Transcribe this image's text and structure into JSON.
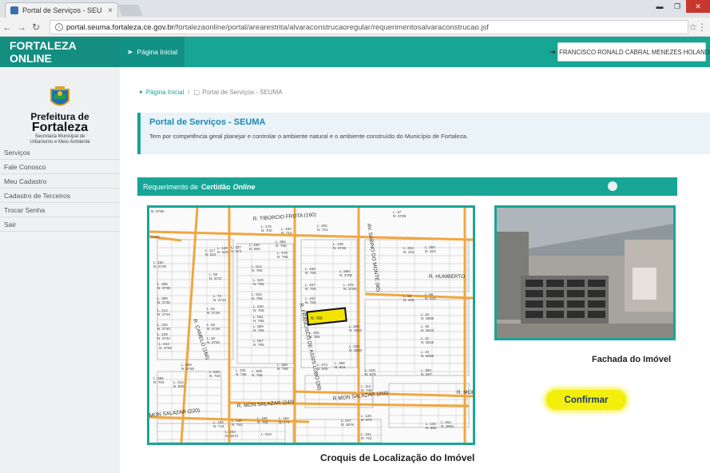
{
  "browser": {
    "tab_title": "Portal de Serviços - SEU",
    "tab_close": "×",
    "url_domain": "portal.seuma.fortaleza.ce.gov.br",
    "url_path": "/fortalezaonline/portal/arearestrita/alvaraconstrucaoregular/requerimentosalvaraconstrucao.jsf",
    "icons": [
      "back-icon",
      "forward-icon",
      "reload-icon",
      "info-icon",
      "star-icon",
      "menu-icon"
    ]
  },
  "header": {
    "brand": "FORTALEZA ONLINE",
    "nav_home": "Página Inicial",
    "user_button": "FRANCISCO RONALD CABRAL MENEZES HOLANDA"
  },
  "sidebar": {
    "logo_line1": "Prefeitura de",
    "logo_line2": "Fortaleza",
    "logo_line3": "Secretaria Municipal de",
    "logo_line4": "Urbanismo e Meio Ambiente",
    "items": [
      {
        "label": "Serviços"
      },
      {
        "label": "Fale Conosco"
      },
      {
        "label": "Meu Cadastro"
      },
      {
        "label": "Cadastro de Terceiros"
      },
      {
        "label": "Trocar Senha"
      },
      {
        "label": "Sair"
      }
    ]
  },
  "breadcrumb": {
    "home": "Página Inicial",
    "separator": "/",
    "current": "Portal de Serviços - SEUMA"
  },
  "portal": {
    "title": "Portal de Serviços - SEUMA",
    "description": "Tem por competência geral planejar e controlar o ambiente natural e o ambiente construído do Município de Fortaleza."
  },
  "request": {
    "prefix": "Requerimento de",
    "bold": "Certidão",
    "italic": "Online"
  },
  "map": {
    "caption": "Croquis de Localização do Imóvel",
    "streets": [
      "R. TIBÚRCIO FROTA (160)",
      "AV. SABINO DO MONTE (60)",
      "R. FRANCISCO DE ASSIS LOBO (30)",
      "R. CAMELO (160)",
      "R. MON SALAZAR (240)",
      "R MON SALAZAR (260)",
      "MON SALAZAR (220)",
      "R. HUMBERTO",
      "R. MON"
    ],
    "highlight_label": "N: 765",
    "lot_labels": [
      "N: 3708",
      "L: 175 N: 700",
      "L: 193 N: 710",
      "L: 202 N: 722",
      "L: 37 N: 3739",
      "(160)",
      "L: 117 N: 622",
      "L: 128 N: 630",
      "L: 137 N: 674",
      "L: 155 N: 690",
      "L: 484 N: 765",
      "L: 478 N: 765",
      "L: 239 N: 3748",
      "L: 402 N: 418",
      "L: 383 N: 423",
      "L: 192 N: 3729",
      "L: 514 N: 765",
      "L: 469 N: 765",
      "L: 268 N: 3780",
      "L: 69 N: 3727",
      "L: 528 N: 765",
      "L: 467 N: 765",
      "L: 278 N: 3788",
      "L: 388 N: 3738",
      "L: 72 N: 3743",
      "L: 534 N: 765",
      "L: 462 N: 765",
      "L: 86 N: 408",
      "L: 88 N: 420",
      "L: 399 N: 3730",
      "L: 540 N: 765",
      "L: 214 N: 3734",
      "L: 81 N: 3748",
      "L: 551 N: 765",
      "L: 430 N: 765",
      "L: 308 N: 3812",
      "L: 42 N: 3808",
      "L: 225 N: 3740",
      "L: 82 N: 3748",
      "L: 550 N: 765",
      "L: 425 N: 765",
      "L: 36 N: 3813",
      "L: 228 N: 3742",
      "L: 40 N: 3750",
      "L: 557 N: 765",
      "L: 320 N: 3830",
      "L: 31 N: 3818",
      "L: 244 N: 3750",
      "L: 23 N: 3826",
      "L: 258 N: 3760",
      "L: 640 N: 730",
      "L: 431 N: 746",
      "L: 408 N: 765",
      "L: 368 N: 798",
      "L: 373 N: 808",
      "L: 355 N: 815",
      "L: 018 N: 878",
      "L: 300 N: 697",
      "L: 286 N: 704",
      "L: 214 N: 830",
      "L: 112 N: 746",
      "L: 123 N: 744",
      "L: 140 N: 752",
      "L: 159 N: 765",
      "L: 182 N: 774",
      "L: 247 N: 3876",
      "L: 128 N: 872",
      "L: 140 N: 882",
      "L: 262 N: 3884",
      "L: 161 N: 722",
      "L: 203 N: 3873",
      "L: 810"
    ]
  },
  "photo": {
    "caption": "Fachada do Imóvel"
  },
  "actions": {
    "confirm": "Confirmar"
  },
  "colors": {
    "teal": "#17a596",
    "teal_dark": "#138e81",
    "portal_title": "#1e88b4",
    "confirm_bg": "#f4ee0c",
    "confirm_text": "#1a3b6b",
    "map_street": "#f0a640",
    "map_highlight": "#f3e400"
  }
}
